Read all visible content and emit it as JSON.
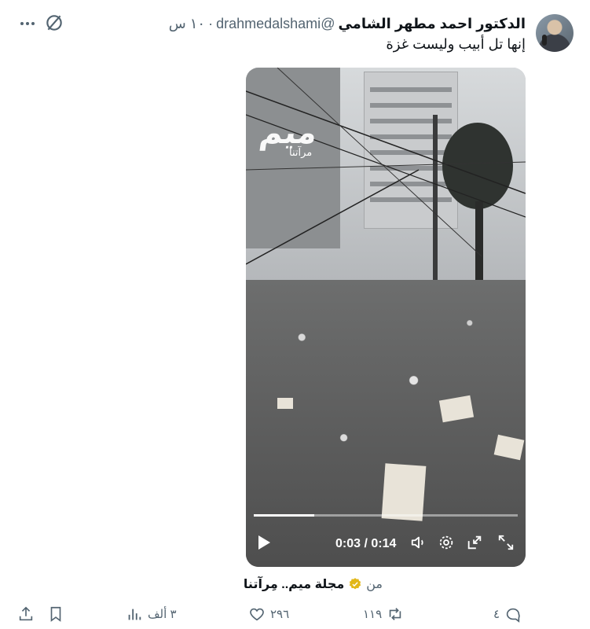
{
  "tweet": {
    "author_name": "الدكتور احمد مطهر الشامي",
    "handle": "@drahmedalshami",
    "separator": "·",
    "time": "١٠ س",
    "text": "إنها تل أبيب وليست غزة"
  },
  "video": {
    "watermark": "ميم",
    "watermark_sub": "مرآتنا",
    "time_display": "0:03 / 0:14",
    "progress": 0.23
  },
  "source": {
    "prefix": "من",
    "name": "مجلة ميم.. مِرآتنا"
  },
  "actions": {
    "replies": "٤",
    "reposts": "١١٩",
    "likes": "٢٩٦",
    "views": "٣ ألف"
  },
  "icons": {
    "more": "more-icon",
    "grok": "grok-icon",
    "reply": "reply-icon",
    "repost": "repost-icon",
    "like": "heart-icon",
    "views": "views-icon",
    "bookmark": "bookmark-icon",
    "share": "share-icon",
    "verified": "verified-badge-icon"
  },
  "colors": {
    "text": "#0f1419",
    "secondary": "#536471",
    "verified_gold": "#e2b719"
  }
}
